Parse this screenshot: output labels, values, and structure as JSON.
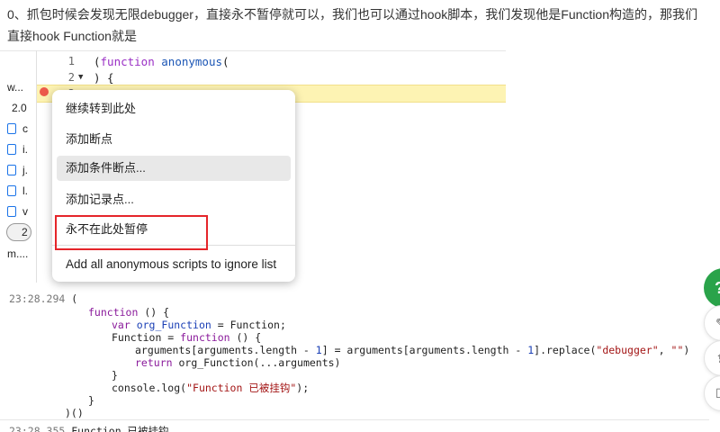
{
  "article": {
    "paragraph": "0、抓包时候会发现无限debugger，直接永不暂停就可以，我们也可以通过hook脚本，我们发现他是Function构造的，那我们直接hook Function就是"
  },
  "devtools": {
    "left_panel": {
      "row1": "w...",
      "row2": "2.0",
      "checkboxes": [
        "c",
        "i.",
        "j.",
        "l.",
        "v"
      ],
      "pill": "2",
      "row_last": "m...."
    },
    "code": {
      "line_numbers": [
        "1",
        "2",
        "3"
      ],
      "line1_paren": "(",
      "line1_kw": "function",
      "line1_name": "anonymous",
      "line1_rest": "(",
      "line2": ") {"
    },
    "context_menu": {
      "items": [
        "继续转到此处",
        "添加断点",
        "添加条件断点...",
        "添加记录点...",
        "永不在此处暂停",
        "Add all anonymous scripts to ignore list"
      ]
    }
  },
  "console": {
    "ts1": "23:28.294",
    "l0": "(",
    "l1_kw": "function",
    "l1_rest": " () {",
    "l2_kw": "var",
    "l2_var": " org_Function",
    "l2_rest": " = Function;",
    "l3_a": "Function = ",
    "l3_kw": "function",
    "l3_rest": " () {",
    "l4_a": "arguments[arguments.length - ",
    "l4_n1": "1",
    "l4_b": "] = arguments[arguments.length - ",
    "l4_n2": "1",
    "l4_c": "].replace(",
    "l4_s1": "\"debugger\"",
    "l4_d": ", ",
    "l4_s2": "\"\"",
    "l4_e": ")",
    "l5_kw": "return",
    "l5_rest": " org_Function(...arguments)",
    "l6": "}",
    "l7_a": "console.log(",
    "l7_s": "\"Function 已被挂钩\"",
    "l7_b": ");",
    "l8": "}",
    "l9": ")()",
    "ts2": "23:28.355",
    "out2": "Function 已被挂钩"
  },
  "side_buttons": {
    "green_icon": "?",
    "gray_icons": [
      "edit-icon",
      "share-icon",
      "comment-icon"
    ],
    "gray_glyphs": [
      "✎",
      "⇪",
      "☐"
    ]
  }
}
